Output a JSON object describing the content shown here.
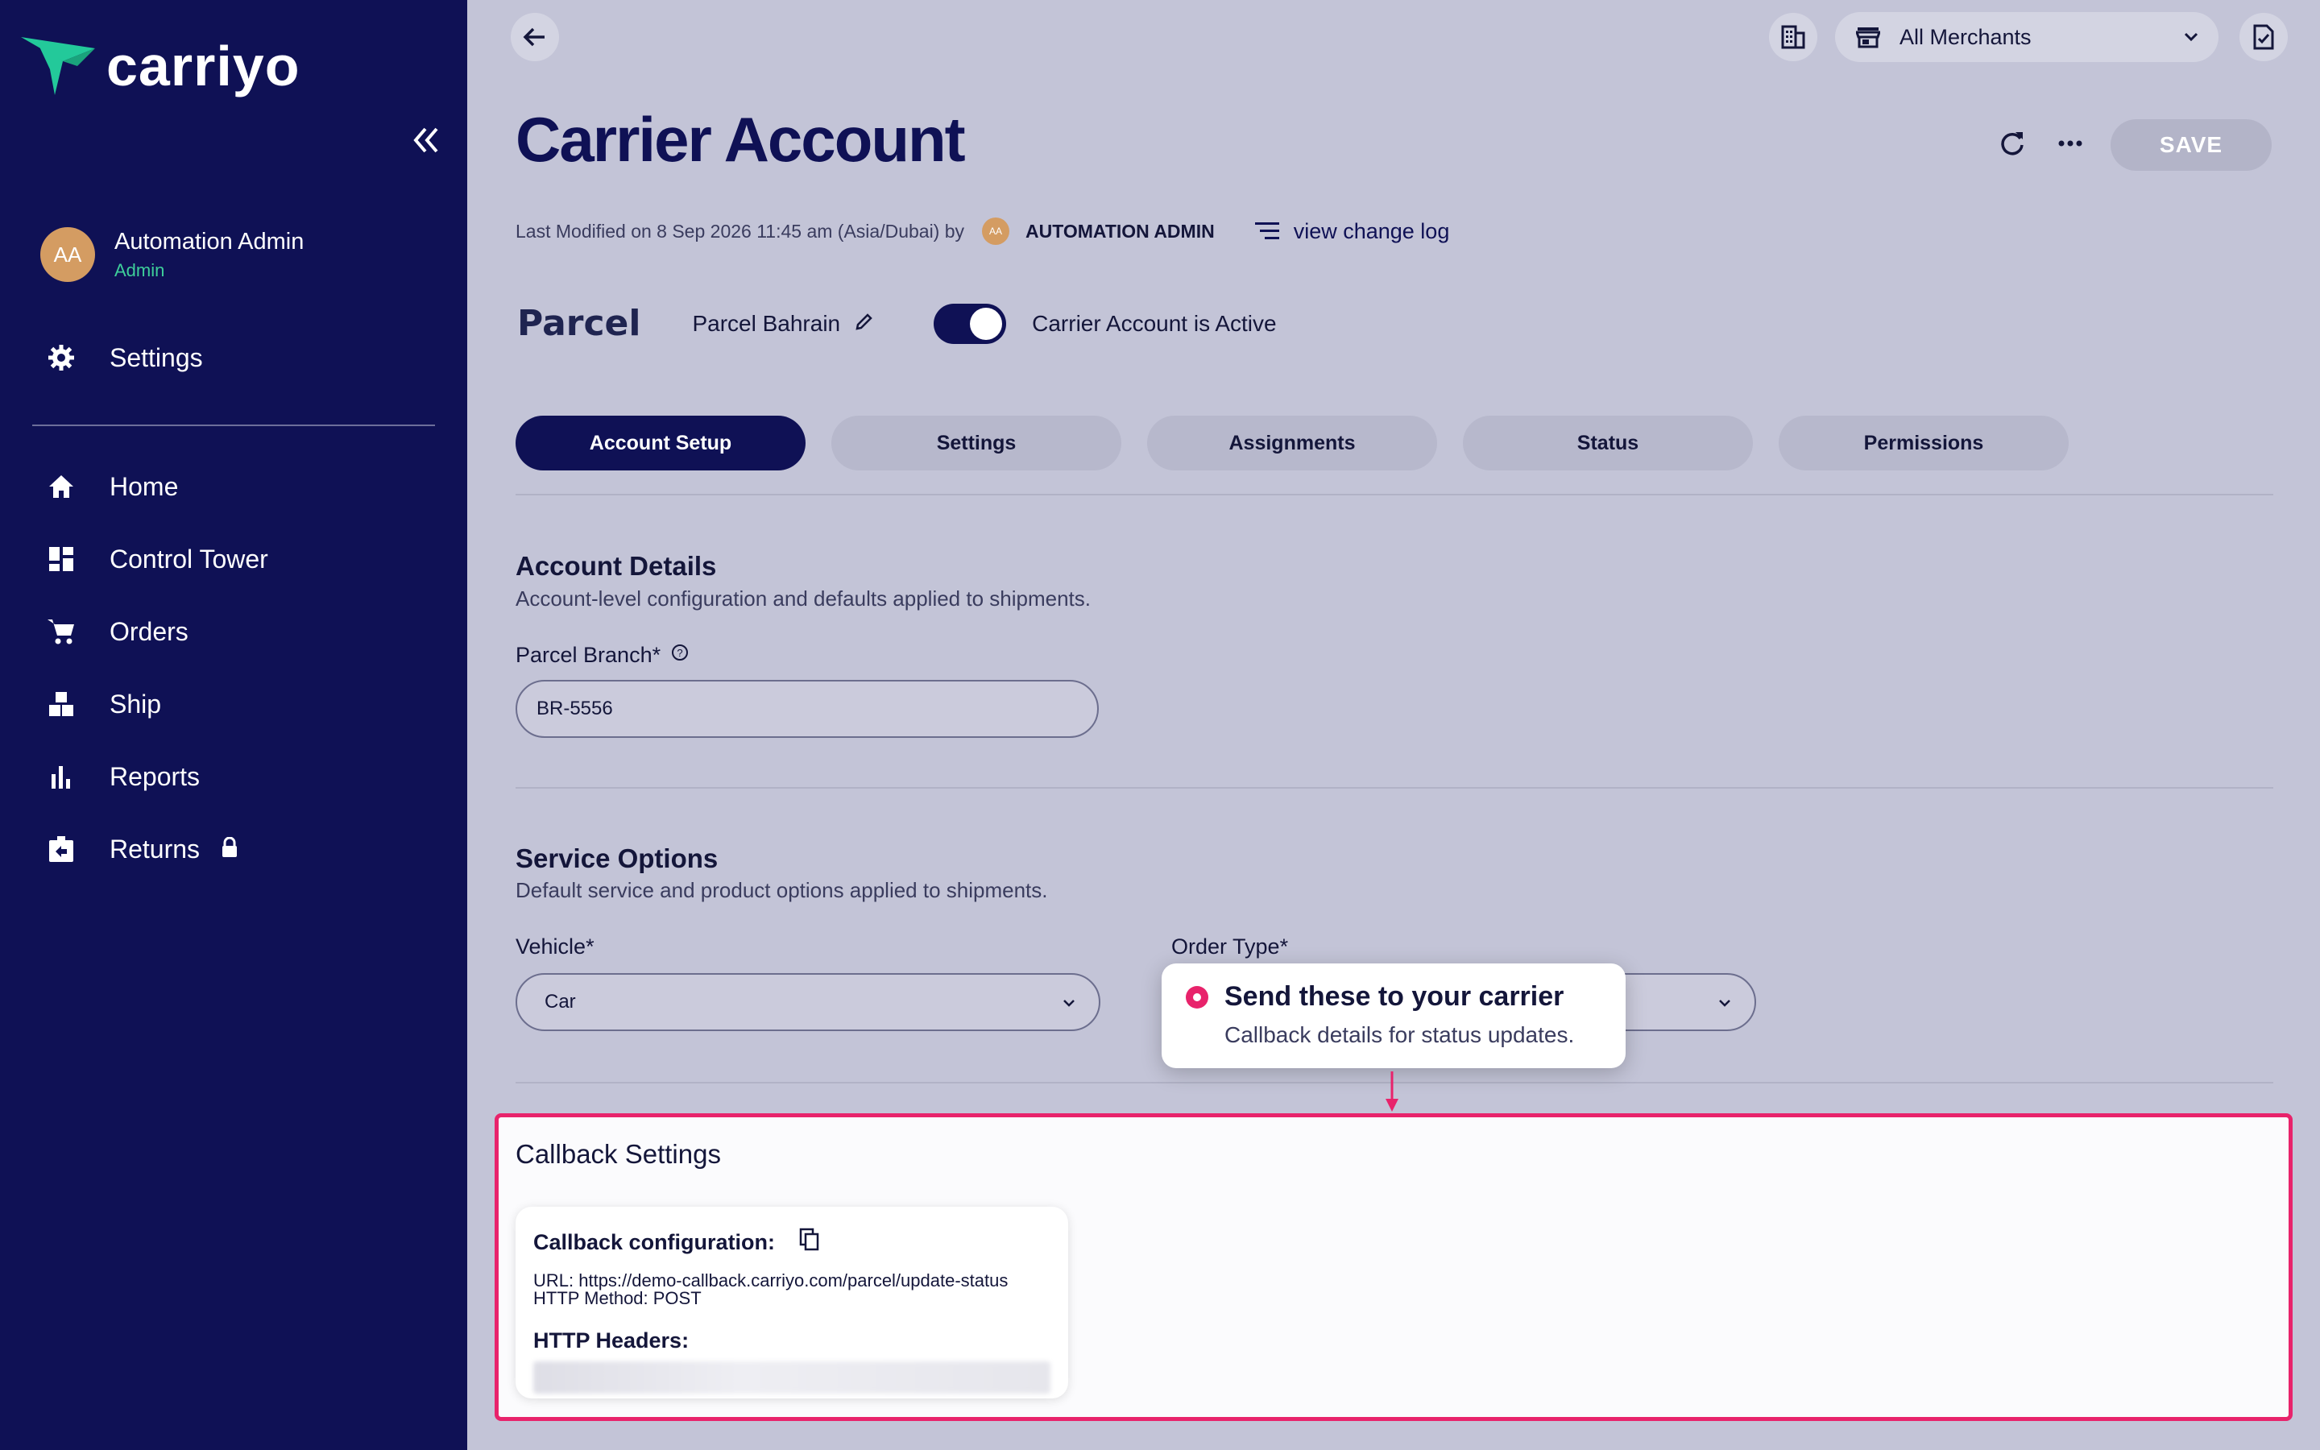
{
  "app": {
    "logo_text": "carriyo",
    "brand_color": "#0f1155",
    "accent_color": "#e8236b"
  },
  "sidebar": {
    "user": {
      "initials": "AA",
      "name": "Automation Admin",
      "role": "Admin"
    },
    "settings_label": "Settings",
    "items": [
      {
        "label": "Home",
        "icon": "home-icon"
      },
      {
        "label": "Control Tower",
        "icon": "dashboard-icon"
      },
      {
        "label": "Orders",
        "icon": "cart-icon"
      },
      {
        "label": "Ship",
        "icon": "boxes-icon"
      },
      {
        "label": "Reports",
        "icon": "bar-chart-icon"
      },
      {
        "label": "Returns",
        "icon": "return-box-icon"
      }
    ]
  },
  "header": {
    "merchant_selector": "All Merchants",
    "title": "Carrier Account",
    "save_label": "SAVE",
    "modified_text": "Last Modified on 8 Sep 2026 11:45 am (Asia/Dubai) by",
    "modified_user_initials": "AA",
    "modified_user": "AUTOMATION ADMIN",
    "change_log_label": "view change log"
  },
  "carrier": {
    "logo_text": "Parcel",
    "account_name": "Parcel Bahrain",
    "active_label": "Carrier Account is Active",
    "active": true
  },
  "tabs": [
    {
      "label": "Account Setup",
      "active": true
    },
    {
      "label": "Settings",
      "active": false
    },
    {
      "label": "Assignments",
      "active": false
    },
    {
      "label": "Status",
      "active": false
    },
    {
      "label": "Permissions",
      "active": false
    }
  ],
  "account_details": {
    "title": "Account Details",
    "subtitle": "Account-level configuration and defaults applied to shipments.",
    "branch_label": "Parcel Branch*",
    "branch_value": "BR-5556"
  },
  "service_options": {
    "title": "Service Options",
    "subtitle": "Default service and product options applied to shipments.",
    "vehicle_label": "Vehicle*",
    "vehicle_value": "Car",
    "order_type_label": "Order Type*"
  },
  "callback": {
    "title": "Callback Settings",
    "config_label": "Callback configuration:",
    "url_line": "URL: https://demo-callback.carriyo.com/parcel/update-status",
    "method_line": "HTTP Method: POST",
    "headers_label": "HTTP Headers:"
  },
  "tooltip": {
    "title": "Send these to your carrier",
    "subtitle": "Callback details for status updates."
  }
}
